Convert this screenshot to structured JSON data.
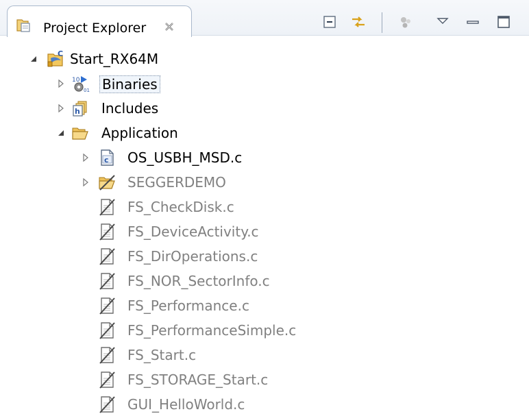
{
  "view": {
    "title": "Project Explorer",
    "tab_icon": "project-explorer-icon",
    "close_icon": "close-x-icon"
  },
  "toolbar": [
    {
      "icon": "collapse-all-icon"
    },
    {
      "icon": "link-with-editor-icon"
    },
    {
      "icon": "customize-view-icon"
    },
    {
      "icon": "view-menu-chevron-icon"
    },
    {
      "icon": "minimize-icon"
    },
    {
      "icon": "maximize-icon"
    }
  ],
  "tree": {
    "project": {
      "label": "Start_RX64M",
      "icon": "c-project-icon",
      "expanded": true
    },
    "binaries": {
      "label": "Binaries",
      "icon": "binaries-icon",
      "expanded": false
    },
    "includes": {
      "label": "Includes",
      "icon": "includes-icon",
      "expanded": false
    },
    "application": {
      "label": "Application",
      "icon": "open-folder-icon",
      "expanded": true
    },
    "os_usbh": {
      "label": "OS_USBH_MSD.c",
      "icon": "c-source-file-icon",
      "expanded": false
    },
    "seggerdemo": {
      "label": "SEGGERDEMO",
      "icon": "excluded-folder-icon",
      "expanded": false
    },
    "files": [
      {
        "label": "FS_CheckDisk.c",
        "icon": "excluded-c-file-icon"
      },
      {
        "label": "FS_DeviceActivity.c",
        "icon": "excluded-c-file-icon"
      },
      {
        "label": "FS_DirOperations.c",
        "icon": "excluded-c-file-icon"
      },
      {
        "label": "FS_NOR_SectorInfo.c",
        "icon": "excluded-c-file-icon"
      },
      {
        "label": "FS_Performance.c",
        "icon": "excluded-c-file-icon"
      },
      {
        "label": "FS_PerformanceSimple.c",
        "icon": "excluded-c-file-icon"
      },
      {
        "label": "FS_Start.c",
        "icon": "excluded-c-file-icon"
      },
      {
        "label": "FS_STORAGE_Start.c",
        "icon": "excluded-c-file-icon"
      },
      {
        "label": "GUI_HelloWorld.c",
        "icon": "excluded-c-file-icon"
      }
    ]
  },
  "colors": {
    "header_bg": "#eef2f7",
    "tab_border": "#a9b8cc",
    "excluded_text": "#808080",
    "selection_bg": "#f0f5fb"
  }
}
